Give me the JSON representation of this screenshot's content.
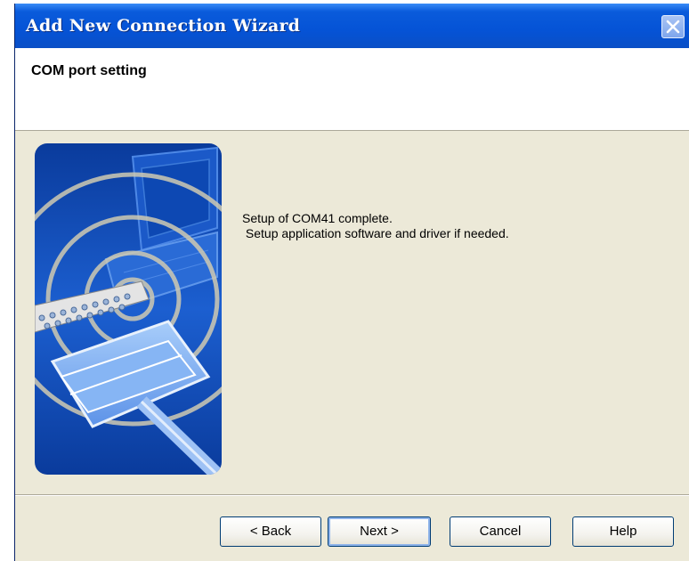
{
  "window": {
    "title": "Add New Connection Wizard"
  },
  "header": {
    "title": "COM port setting"
  },
  "illustration": {
    "description_icon": "serial-connection-illustration",
    "colors": {
      "dark_blue": "#0b3d9e",
      "light_blue": "#7eb0f5",
      "ring": "#c9c5b0"
    }
  },
  "message": {
    "line1": "Setup of COM41 complete.",
    "line2": " Setup application software and driver if needed."
  },
  "buttons": {
    "back": "< Back",
    "next": "Next >",
    "cancel": "Cancel",
    "help": "Help"
  },
  "icons": {
    "close": "close-icon"
  }
}
